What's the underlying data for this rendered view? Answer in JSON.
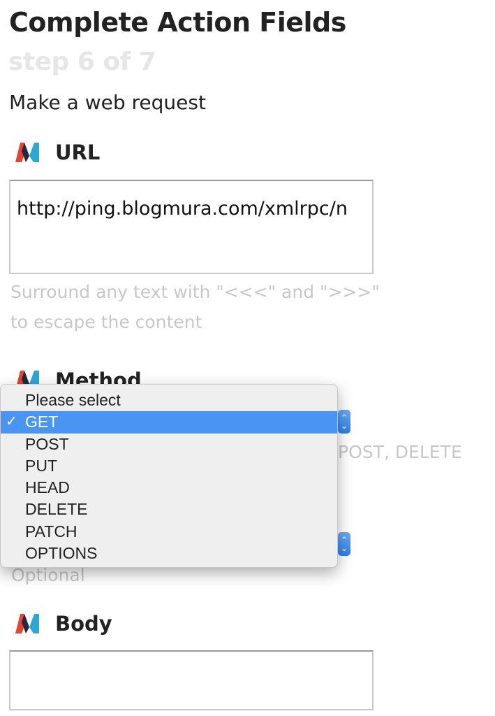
{
  "header": {
    "title": "Complete Action Fields",
    "step": "step 6 of 7",
    "action": "Make a web request"
  },
  "fields": {
    "url": {
      "label": "URL",
      "value": "http://ping.blogmura.com/xmlrpc/n",
      "hint_line1": "Surround any text with \"<<<\" and \">>>\"",
      "hint_line2": "to escape the content"
    },
    "method": {
      "label": "Method",
      "hint_visible": "POST, DELETE"
    },
    "content_type": {
      "hint_visible": "Optional"
    },
    "body": {
      "label": "Body",
      "value": ""
    }
  },
  "service_icon": {
    "name": "maker-webhooks-icon",
    "colors": [
      "#e8432e",
      "#2aa8d8",
      "#1f2b44"
    ]
  },
  "dropdown": {
    "check_glyph": "✓",
    "selected_index": 1,
    "options": [
      "Please select",
      "GET",
      "POST",
      "PUT",
      "HEAD",
      "DELETE",
      "PATCH",
      "OPTIONS"
    ]
  },
  "colors": {
    "selection": "#4a94f3",
    "stepper": "#3d8bf0",
    "muted_text": "#c8c8c8"
  }
}
